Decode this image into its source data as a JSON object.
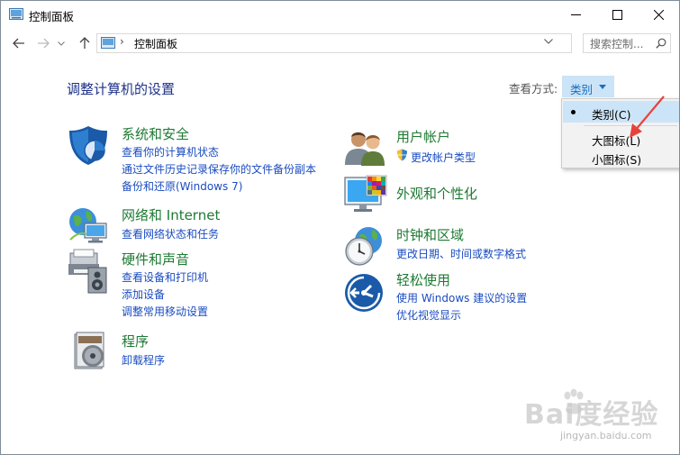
{
  "window": {
    "title": "控制面板",
    "controls": [
      "minimize-icon",
      "maximize-icon",
      "close-icon"
    ]
  },
  "address_bar": {
    "separator": "›",
    "path": "控制面板",
    "search_placeholder": "搜索控制..."
  },
  "main": {
    "heading": "调整计算机的设置",
    "view_by_label": "查看方式:",
    "view_by_value": "类别"
  },
  "categories": {
    "system": {
      "title": "系统和安全",
      "links": [
        "查看你的计算机状态",
        "通过文件历史记录保存你的文件备份副本",
        "备份和还原(Windows 7)"
      ],
      "icon": "shield-icon"
    },
    "network": {
      "title": "网络和 Internet",
      "links": [
        "查看网络状态和任务"
      ],
      "icon": "network-globe-icon"
    },
    "hardware": {
      "title": "硬件和声音",
      "links": [
        "查看设备和打印机",
        "添加设备",
        "调整常用移动设置"
      ],
      "icon": "printer-speaker-icon"
    },
    "programs": {
      "title": "程序",
      "links": [
        "卸载程序"
      ],
      "icon": "programs-disc-icon"
    },
    "users": {
      "title": "用户帐户",
      "links": [
        "更改帐户类型"
      ],
      "icon": "users-icon"
    },
    "appearance": {
      "title": "外观和个性化",
      "links": [],
      "icon": "monitor-palette-icon"
    },
    "clock": {
      "title": "时钟和区域",
      "links": [
        "更改日期、时间或数字格式"
      ],
      "icon": "clock-globe-icon"
    },
    "ease": {
      "title": "轻松使用",
      "links": [
        "使用 Windows 建议的设置",
        "优化视觉显示"
      ],
      "icon": "ease-of-access-icon"
    }
  },
  "view_menu": {
    "items": [
      {
        "label": "类别(C)",
        "selected": true
      },
      {
        "label": "大图标(L)",
        "selected": false
      },
      {
        "label": "小图标(S)",
        "selected": false
      }
    ]
  },
  "watermark": {
    "brand": "Bai度经验",
    "url": "jingyan.baidu.com"
  },
  "colors": {
    "category_title": "#1e7a33",
    "link": "#1a4cc0",
    "heading": "#1e3287",
    "menu_selected": "#cce4f7",
    "annotation_arrow": "#e8413b"
  }
}
